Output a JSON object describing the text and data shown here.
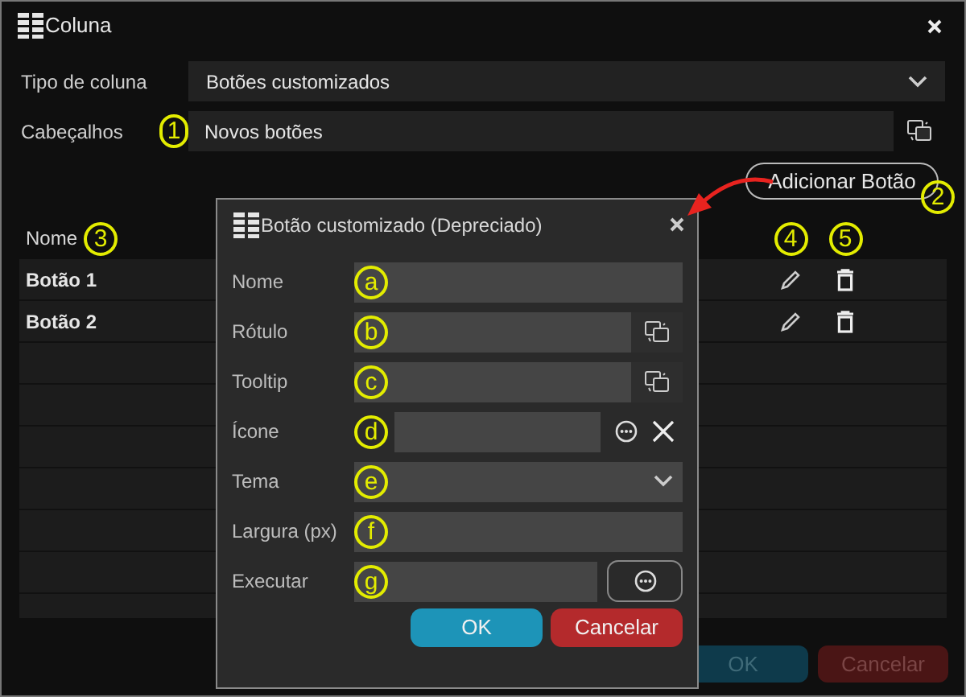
{
  "window": {
    "title": "Coluna"
  },
  "form": [
    {
      "label": "Tipo de coluna",
      "kind": "select",
      "value": "Botões customizados"
    },
    {
      "label": "Cabeçalhos",
      "kind": "translate",
      "value": "Novos botões",
      "marker": "1"
    }
  ],
  "add_button": {
    "label": "Adicionar Botão",
    "marker": "2"
  },
  "table": {
    "columns": [
      {
        "label": "Nome",
        "marker": "3"
      },
      {
        "marker": "4"
      },
      {
        "marker": "5"
      }
    ],
    "rows": [
      {
        "name": "Botão 1"
      },
      {
        "name": "Botão 2"
      }
    ]
  },
  "buttons": [
    {
      "label": "OK",
      "kind": "primary"
    },
    {
      "label": "Cancelar",
      "kind": "danger"
    }
  ],
  "dialog": {
    "title": "Botão customizado (Depreciado)",
    "fields": [
      {
        "label": "Nome",
        "kind": "text",
        "marker": "a"
      },
      {
        "label": "Rótulo",
        "kind": "translate",
        "marker": "b"
      },
      {
        "label": "Tooltip",
        "kind": "translate",
        "marker": "c"
      },
      {
        "label": "Ícone",
        "kind": "icon",
        "marker": "d"
      },
      {
        "label": "Tema",
        "kind": "select",
        "marker": "e"
      },
      {
        "label": "Largura (px)",
        "kind": "text",
        "marker": "f"
      },
      {
        "label": "Executar",
        "kind": "action",
        "marker": "g"
      }
    ],
    "buttons": [
      {
        "label": "OK",
        "kind": "primary"
      },
      {
        "label": "Cancelar",
        "kind": "danger"
      }
    ]
  }
}
